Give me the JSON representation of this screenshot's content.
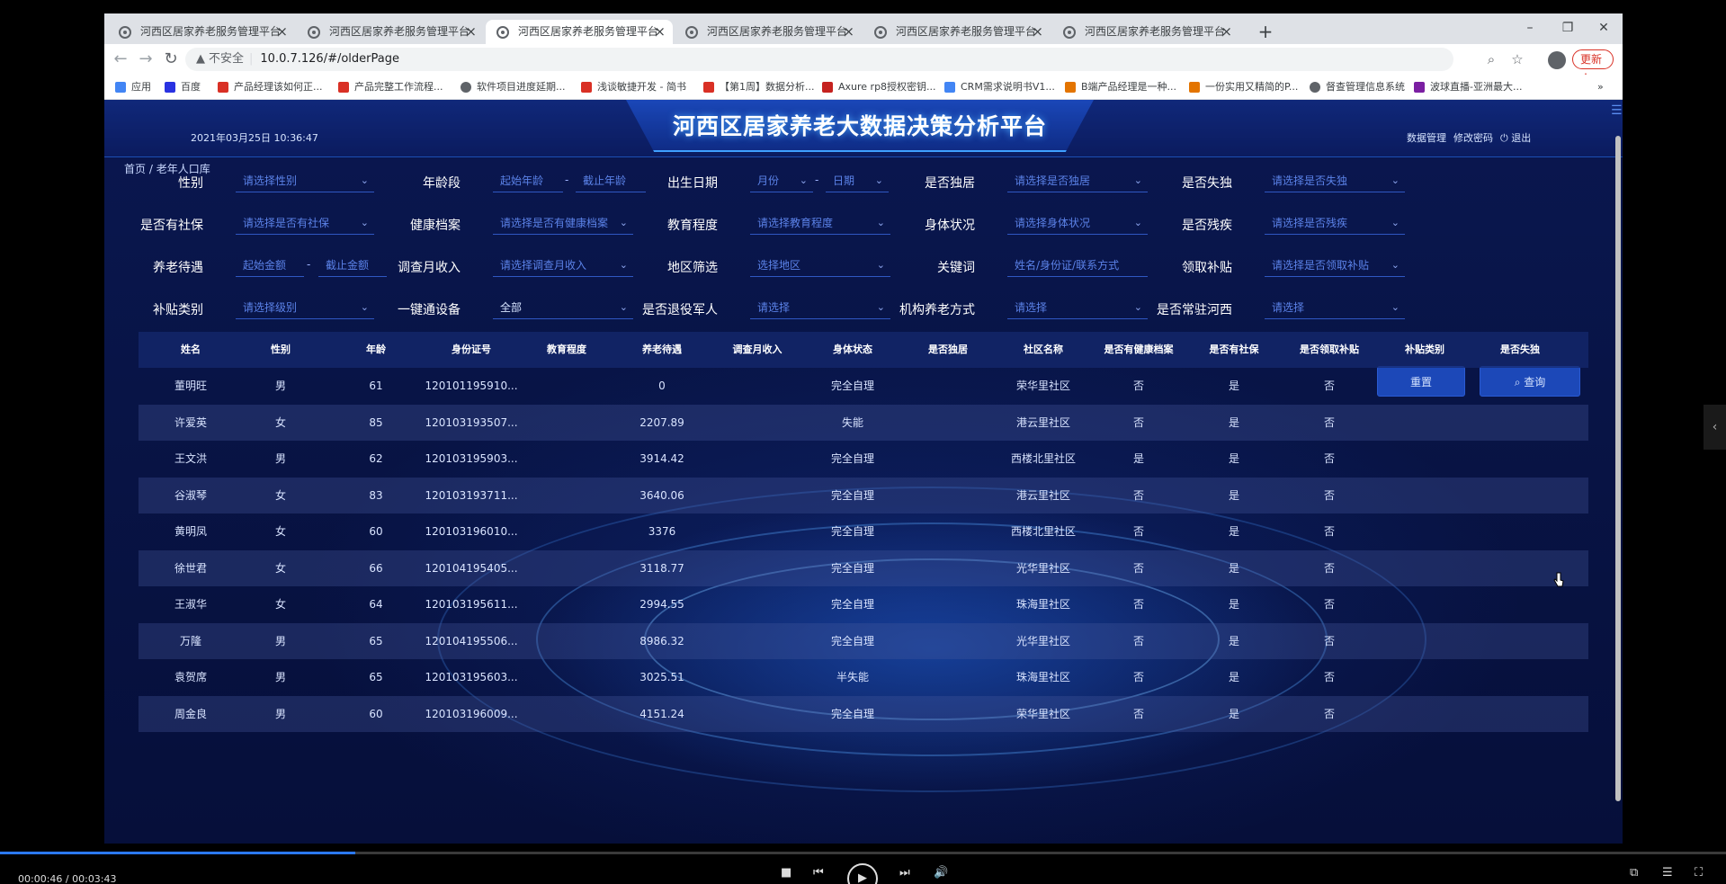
{
  "browser": {
    "tabs": [
      {
        "title": "河西区居家养老服务管理平台",
        "active": false
      },
      {
        "title": "河西区居家养老服务管理平台",
        "active": false
      },
      {
        "title": "河西区居家养老服务管理平台",
        "active": true
      },
      {
        "title": "河西区居家养老服务管理平台",
        "active": false
      },
      {
        "title": "河西区居家养老服务管理平台",
        "active": false
      },
      {
        "title": "河西区居家养老服务管理平台",
        "active": false
      }
    ],
    "new_tab": "+",
    "insecure_label": "不安全",
    "url": "10.0.7.126/#/olderPage",
    "update_label": "更新",
    "bookmarks": [
      {
        "label": "应用",
        "color": "#4285f4"
      },
      {
        "label": "百度",
        "color": "#2932e1"
      },
      {
        "label": "产品经理该如何正...",
        "color": "#d93025"
      },
      {
        "label": "产品完整工作流程...",
        "color": "#d93025"
      },
      {
        "label": "软件项目进度延期...",
        "color": "#5f6368"
      },
      {
        "label": "浅谈敏捷开发 - 简书",
        "color": "#d93025"
      },
      {
        "label": "【第1周】数据分析...",
        "color": "#d93025"
      },
      {
        "label": "Axure rp8授权密钥...",
        "color": "#c5221f"
      },
      {
        "label": "CRM需求说明书V1...",
        "color": "#4285f4"
      },
      {
        "label": "B端产品经理是一种...",
        "color": "#e37400"
      },
      {
        "label": "一份实用又精简的P...",
        "color": "#e37400"
      },
      {
        "label": "督查管理信息系统",
        "color": "#5f6368"
      },
      {
        "label": "波球直播-亚洲最大...",
        "color": "#7b1fa2"
      }
    ]
  },
  "header": {
    "title": "河西区居家养老大数据决策分析平台",
    "datetime": "2021年03月25日 10:36:47",
    "links": {
      "data_manage": "数据管理",
      "change_password": "修改密码",
      "logout": "退出"
    }
  },
  "breadcrumb": {
    "home": "首页",
    "sep": "/",
    "current": "老年人口库"
  },
  "filters": {
    "gender": {
      "label": "性别",
      "placeholder": "请选择性别"
    },
    "age": {
      "label": "年龄段",
      "start": "起始年龄",
      "dash": "-",
      "end": "截止年龄"
    },
    "birth": {
      "label": "出生日期",
      "month": "月份",
      "dash": "-",
      "day": "日期"
    },
    "alone": {
      "label": "是否独居",
      "placeholder": "请选择是否独居"
    },
    "lost_only_child": {
      "label": "是否失独",
      "placeholder": "请选择是否失独"
    },
    "social_security": {
      "label": "是否有社保",
      "placeholder": "请选择是否有社保"
    },
    "health_record": {
      "label": "健康档案",
      "placeholder": "请选择是否有健康档案"
    },
    "education": {
      "label": "教育程度",
      "placeholder": "请选择教育程度"
    },
    "health_status": {
      "label": "身体状况",
      "placeholder": "请选择身体状况"
    },
    "disabled": {
      "label": "是否残疾",
      "placeholder": "请选择是否残疾"
    },
    "pension": {
      "label": "养老待遇",
      "start": "起始金额",
      "dash": "-",
      "end": "截止金额"
    },
    "monthly_income": {
      "label": "调查月收入",
      "placeholder": "请选择调查月收入"
    },
    "region": {
      "label": "地区筛选",
      "placeholder": "选择地区"
    },
    "keyword": {
      "label": "关键词",
      "placeholder": "姓名/身份证/联系方式"
    },
    "subsidy_received": {
      "label": "领取补贴",
      "placeholder": "请选择是否领取补贴"
    },
    "subsidy_type": {
      "label": "补贴类别",
      "placeholder": "请选择级别"
    },
    "one_touch_device": {
      "label": "一键通设备",
      "value": "全部"
    },
    "veteran": {
      "label": "是否退役军人",
      "placeholder": "请选择"
    },
    "institution_mode": {
      "label": "机构养老方式",
      "placeholder": "请选择"
    },
    "resident_hexi": {
      "label": "是否常驻河西",
      "placeholder": "请选择"
    }
  },
  "buttons": {
    "reset": "重置",
    "query": "查询"
  },
  "table": {
    "columns": [
      "姓名",
      "性别",
      "年龄",
      "身份证号",
      "教育程度",
      "养老待遇",
      "调查月收入",
      "身体状态",
      "是否独居",
      "社区名称",
      "是否有健康档案",
      "是否有社保",
      "是否领取补贴",
      "补贴类别",
      "是否失独"
    ],
    "rows": [
      [
        "董明旺",
        "男",
        "61",
        "120101195910...",
        "",
        "0",
        "",
        "完全自理",
        "",
        "荣华里社区",
        "否",
        "是",
        "否",
        "",
        ""
      ],
      [
        "许爱英",
        "女",
        "85",
        "120103193507...",
        "",
        "2207.89",
        "",
        "失能",
        "",
        "港云里社区",
        "否",
        "是",
        "否",
        "",
        ""
      ],
      [
        "王文洪",
        "男",
        "62",
        "120103195903...",
        "",
        "3914.42",
        "",
        "完全自理",
        "",
        "西楼北里社区",
        "是",
        "是",
        "否",
        "",
        ""
      ],
      [
        "谷淑琴",
        "女",
        "83",
        "120103193711...",
        "",
        "3640.06",
        "",
        "完全自理",
        "",
        "港云里社区",
        "否",
        "是",
        "否",
        "",
        ""
      ],
      [
        "黄明凤",
        "女",
        "60",
        "120103196010...",
        "",
        "3376",
        "",
        "完全自理",
        "",
        "西楼北里社区",
        "否",
        "是",
        "否",
        "",
        ""
      ],
      [
        "徐世君",
        "女",
        "66",
        "120104195405...",
        "",
        "3118.77",
        "",
        "完全自理",
        "",
        "光华里社区",
        "否",
        "是",
        "否",
        "",
        ""
      ],
      [
        "王淑华",
        "女",
        "64",
        "120103195611...",
        "",
        "2994.55",
        "",
        "完全自理",
        "",
        "珠海里社区",
        "否",
        "是",
        "否",
        "",
        ""
      ],
      [
        "万隆",
        "男",
        "65",
        "120104195506...",
        "",
        "8986.32",
        "",
        "完全自理",
        "",
        "光华里社区",
        "否",
        "是",
        "否",
        "",
        ""
      ],
      [
        "袁贺席",
        "男",
        "65",
        "120103195603...",
        "",
        "3025.51",
        "",
        "半失能",
        "",
        "珠海里社区",
        "否",
        "是",
        "否",
        "",
        ""
      ],
      [
        "周金良",
        "男",
        "60",
        "120103196009...",
        "",
        "4151.24",
        "",
        "完全自理",
        "",
        "荣华里社区",
        "否",
        "是",
        "否",
        "",
        ""
      ]
    ]
  },
  "player": {
    "current_time": "00:00:46",
    "separator": " / ",
    "duration": "00:03:43",
    "progress": 0.206
  }
}
